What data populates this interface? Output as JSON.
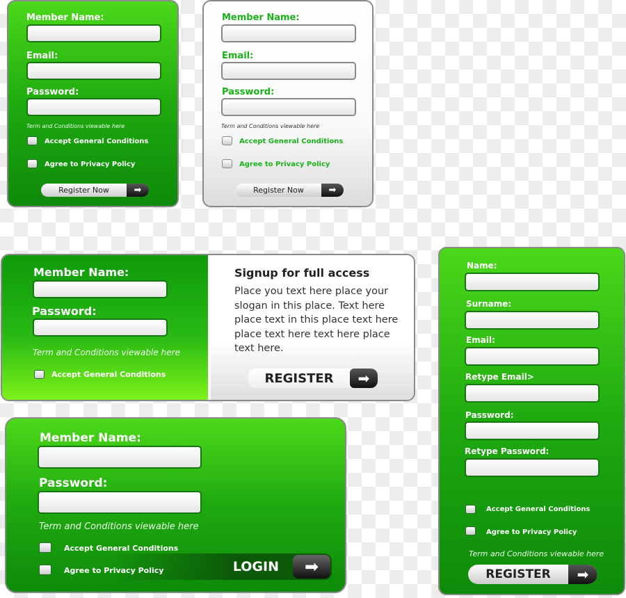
{
  "form1": {
    "member_name": "Member Name:",
    "email": "Email:",
    "password": "Password:",
    "terms": "Term and Conditions viewable here",
    "accept": "Accept General Conditions",
    "privacy": "Agree to Privacy Policy",
    "button": "Register  Now",
    "theme_color": "#2cbf14"
  },
  "form2": {
    "member_name": "Member Name:",
    "email": "Email:",
    "password": "Password:",
    "terms": "Term and Conditions viewable here",
    "accept": "Accept General Conditions",
    "privacy": "Agree to Privacy Policy",
    "button": "Register  Now"
  },
  "form3": {
    "member_name": "Member Name:",
    "password": "Password:",
    "terms": "Term and Conditions viewable here",
    "accept": "Accept General Conditions",
    "heading": "Signup for full access",
    "body": "Place you text here place your slogan in this place. Text here place text in this place text here place text here text here place text here.",
    "button": "REGISTER"
  },
  "form4": {
    "member_name": "Member Name:",
    "password": "Password:",
    "terms": "Term and Conditions viewable here",
    "accept": "Accept General Conditions",
    "privacy": "Agree to Privacy Policy",
    "button": "LOGIN"
  },
  "form5": {
    "name": "Name:",
    "surname": "Surname:",
    "email": "Email:",
    "retype_email": "Retype Email>",
    "password": "Password:",
    "retype_password": "Retype Password:",
    "accept": "Accept General Conditions",
    "privacy": "Agree to Privacy Policy",
    "terms": "Term and Conditions viewable here",
    "button": "REGISTER"
  },
  "icons": {
    "arrow": "arrow-right-icon"
  }
}
